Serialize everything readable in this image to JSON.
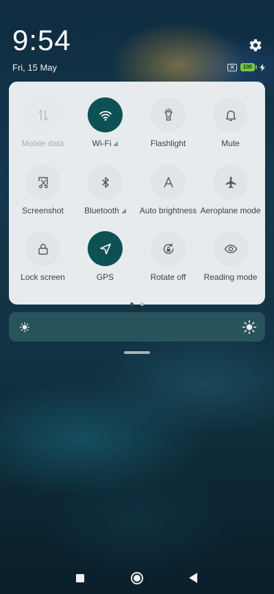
{
  "status": {
    "time": "9:54",
    "date": "Fri, 15 May",
    "battery_level": "100"
  },
  "tiles": [
    {
      "label": "Mobile data",
      "icon": "mobile-data-icon",
      "state": "disabled"
    },
    {
      "label": "Wi-Fi",
      "icon": "wifi-icon",
      "state": "on"
    },
    {
      "label": "Flashlight",
      "icon": "flashlight-icon",
      "state": "off"
    },
    {
      "label": "Mute",
      "icon": "bell-icon",
      "state": "off"
    },
    {
      "label": "Screenshot",
      "icon": "screenshot-icon",
      "state": "off"
    },
    {
      "label": "Bluetooth",
      "icon": "bluetooth-icon",
      "state": "off"
    },
    {
      "label": "Auto brightness",
      "icon": "auto-brightness-icon",
      "state": "off"
    },
    {
      "label": "Aeroplane mode",
      "icon": "airplane-icon",
      "state": "off"
    },
    {
      "label": "Lock screen",
      "icon": "lock-icon",
      "state": "off"
    },
    {
      "label": "GPS",
      "icon": "location-arrow-icon",
      "state": "on"
    },
    {
      "label": "Rotate off",
      "icon": "rotate-lock-icon",
      "state": "off"
    },
    {
      "label": "Reading mode",
      "icon": "eye-icon",
      "state": "off"
    }
  ],
  "pager": {
    "pages": 2,
    "current": 1
  },
  "colors": {
    "tile_on": "#0e5155",
    "tile_off": "#e1e5e8",
    "battery": "#77c74b",
    "panel": "#f0f3f5"
  },
  "navigation": [
    "recents-icon",
    "home-icon",
    "back-icon"
  ]
}
